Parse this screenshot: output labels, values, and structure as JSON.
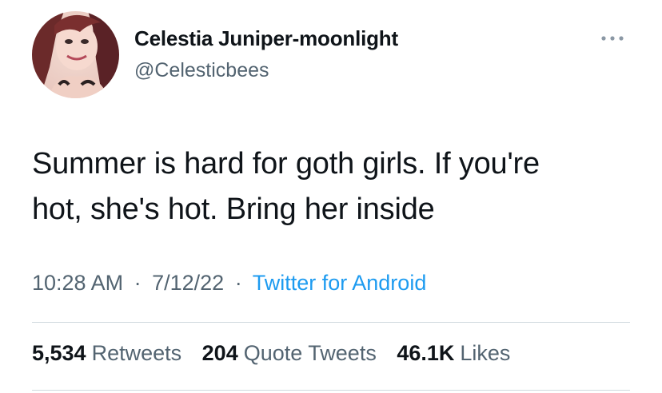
{
  "author": {
    "display_name": "Celestia Juniper-moonlight",
    "handle": "@Celesticbees"
  },
  "tweet": {
    "text_line1": "Summer is hard for goth girls. If you're",
    "text_line2": "hot, she's hot. Bring her inside",
    "time": "10:28 AM",
    "date": "7/12/22",
    "separator": "·",
    "source": "Twitter for Android"
  },
  "stats": {
    "retweets_count": "5,534",
    "retweets_label": "Retweets",
    "quotes_count": "204",
    "quotes_label": "Quote Tweets",
    "likes_count": "46.1K",
    "likes_label": "Likes"
  },
  "icons": {
    "more": "more-options-icon"
  },
  "colors": {
    "text": "#0f1419",
    "secondary": "#536471",
    "link": "#1d9bf0",
    "divider": "#cfd9de"
  }
}
